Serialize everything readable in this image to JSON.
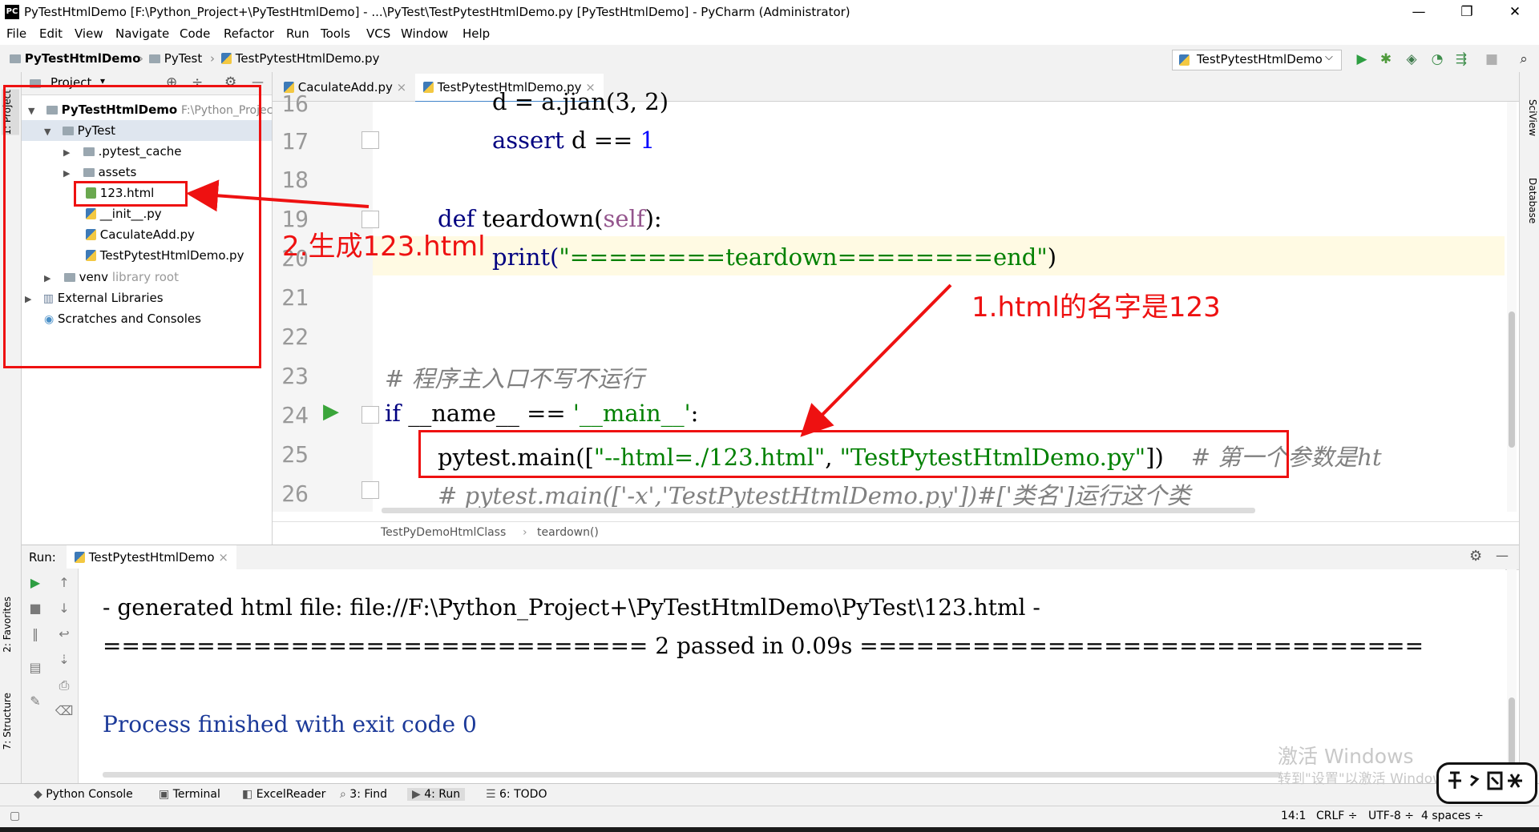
{
  "window": {
    "title": "PyTestHtmlDemo [F:\\Python_Project+\\PyTestHtmlDemo] - ...\\PyTest\\TestPytestHtmlDemo.py [PyTestHtmlDemo] - PyCharm (Administrator)",
    "logo": "PC",
    "minimize_glyph": "—",
    "restore_glyph": "❐",
    "close_glyph": "✕"
  },
  "menu": [
    "File",
    "Edit",
    "View",
    "Navigate",
    "Code",
    "Refactor",
    "Run",
    "Tools",
    "VCS",
    "Window",
    "Help"
  ],
  "navbar": {
    "project": "PyTestHtmlDemo",
    "folder": "PyTest",
    "file": "TestPytestHtmlDemo.py",
    "sep": "›",
    "run_config": "TestPytestHtmlDemo",
    "run_config_arrow": "⌵",
    "tools": [
      {
        "icon": "run-icon",
        "glyph": "▶",
        "color": "#2e9e42"
      },
      {
        "icon": "debug-icon",
        "glyph": "✱",
        "color": "#4f9a3c"
      },
      {
        "icon": "coverage-icon",
        "glyph": "◈",
        "color": "#3f7a4c"
      },
      {
        "icon": "profile-icon",
        "glyph": "◔",
        "color": "#3f8e4c"
      },
      {
        "icon": "concurrency-icon",
        "glyph": "⇶",
        "color": "#3f8e4c"
      },
      {
        "icon": "stop-icon",
        "glyph": "■",
        "color": "#b0b0b0"
      },
      {
        "icon": "search-icon",
        "glyph": "⌕",
        "color": "#333333"
      }
    ]
  },
  "left_stripe": {
    "project_tab": "1: Project",
    "favorites_tab": "2: Favorites",
    "structure_tab": "7: Structure"
  },
  "right_stripe": {
    "sciview_tab": "SciView",
    "database_tab": "Database"
  },
  "project_panel": {
    "header": "Project",
    "header_arrow": "▾",
    "header_icons": [
      "⊕",
      "÷",
      "⚙",
      "—"
    ],
    "root_name": "PyTestHtmlDemo",
    "root_path": "F:\\Python_Project",
    "items": [
      {
        "label": "PyTest",
        "extra": ""
      },
      {
        "label": ".pytest_cache",
        "extra": ""
      },
      {
        "label": "assets",
        "extra": ""
      },
      {
        "label": "123.html",
        "extra": ""
      },
      {
        "label": "__init__.py",
        "extra": ""
      },
      {
        "label": "CaculateAdd.py",
        "extra": ""
      },
      {
        "label": "TestPytestHtmlDemo.py",
        "extra": ""
      },
      {
        "label": "venv",
        "extra": "library root"
      },
      {
        "label": "External Libraries",
        "extra": ""
      },
      {
        "label": "Scratches and Consoles",
        "extra": ""
      }
    ]
  },
  "editor": {
    "tabs": [
      {
        "label": "CaculateAdd.py",
        "close": "×"
      },
      {
        "label": "TestPytestHtmlDemo.py",
        "close": "×"
      }
    ],
    "line_numbers": [
      "16",
      "17",
      "18",
      "19",
      "20",
      "21",
      "22",
      "23",
      "24",
      "25",
      "26"
    ],
    "line16": "d = a.jian(3, 2)",
    "line17": {
      "kw": "assert",
      "rest": " d == ",
      "num": "1"
    },
    "line19": {
      "kw": "def",
      "name": " teardown(",
      "self": "self",
      "end": "):"
    },
    "line20": {
      "fn": "print(",
      "str": "\"========teardown========end\"",
      "end": ")"
    },
    "line23": "# 程序主入口不写不运行",
    "line24": {
      "kw": "if",
      "name": " __name__ == ",
      "str": "'__main__'",
      "end": ":"
    },
    "line25": {
      "fn": "pytest.main([",
      "str1": "\"--html=./123.html\"",
      "sep": ", ",
      "str2": "\"TestPytestHtmlDemo.py\"",
      "end": "])",
      "comment": "# 第一个参数是ht"
    },
    "line26": "# pytest.main(['-x','TestPytestHtmlDemo.py'])#['类名']运行这个类",
    "breadcrumb": [
      "TestPyDemoHtmlClass",
      "teardown()"
    ],
    "breadcrumb_sep": "›"
  },
  "run_panel": {
    "label": "Run:",
    "tab": "TestPytestHtmlDemo",
    "tab_close": "×",
    "settings_glyph": "⚙",
    "hide_glyph": "—",
    "output": [
      "- generated html file: file://F:\\Python_Project+\\PyTestHtmlDemo\\PyTest\\123.html -",
      "============================= 2 passed in 0.09s ==============================",
      "Process finished with exit code 0"
    ]
  },
  "tool_tabs": [
    {
      "label": "Python Console",
      "icon": "python-console-icon"
    },
    {
      "label": "Terminal",
      "icon": "terminal-icon"
    },
    {
      "label": "ExcelReader",
      "icon": "excel-reader-icon"
    },
    {
      "label": "3: Find",
      "icon": "search-icon"
    },
    {
      "label": "4: Run",
      "icon": "run-icon"
    },
    {
      "label": "6: TODO",
      "icon": "todo-icon"
    }
  ],
  "status": {
    "position": "14:1",
    "line_sep": "CRLF ÷",
    "encoding": "UTF-8 ÷",
    "indent": "4 spaces ÷"
  },
  "annotations": {
    "label2": "2.生成123.html",
    "label1": "1.html的名字是123",
    "color": "#ee1111"
  },
  "watermark": {
    "line1": "激活 Windows",
    "line2": "转到\"设置\"以激活 Windows。"
  }
}
